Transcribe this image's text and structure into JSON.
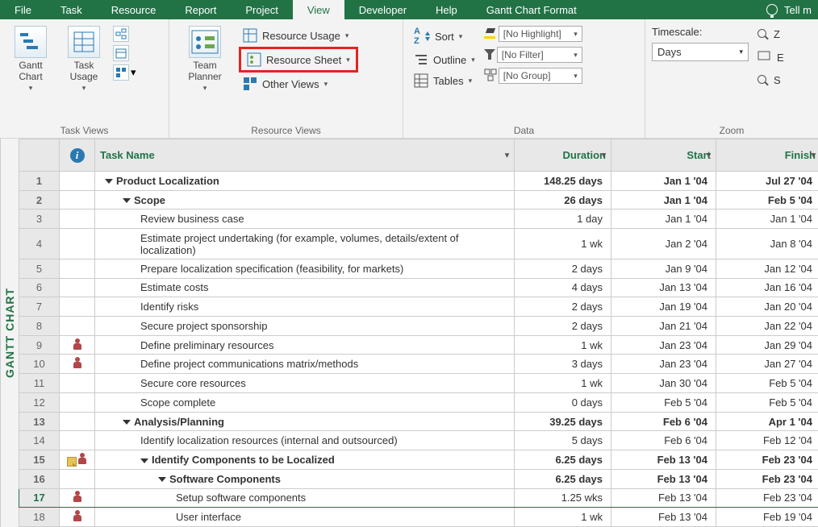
{
  "tabs": [
    "File",
    "Task",
    "Resource",
    "Report",
    "Project",
    "View",
    "Developer",
    "Help",
    "Gantt Chart Format"
  ],
  "active_tab": "View",
  "tellme": "Tell m",
  "ribbon": {
    "gantt_btn": "Gantt\nChart",
    "task_usage_btn": "Task\nUsage",
    "team_planner_btn": "Team\nPlanner",
    "resource_usage": "Resource Usage",
    "resource_sheet": "Resource Sheet",
    "other_views": "Other Views",
    "sort": "Sort",
    "outline": "Outline",
    "tables": "Tables",
    "no_highlight": "[No Highlight]",
    "no_filter": "[No Filter]",
    "no_group": "[No Group]",
    "timescale_label": "Timescale:",
    "timescale_value": "Days",
    "zoom_z": "Z",
    "zoom_e": "E",
    "zoom_s": "S",
    "group_task_views": "Task Views",
    "group_resource_views": "Resource Views",
    "group_data": "Data",
    "group_zoom": "Zoom"
  },
  "rot": "GANTT CHART",
  "columns": {
    "task_name": "Task Name",
    "duration": "Duration",
    "start": "Start",
    "finish": "Finish"
  },
  "rows": [
    {
      "n": 1,
      "ind": "",
      "lvl": 0,
      "sum": true,
      "name": "Product Localization",
      "dur": "148.25 days",
      "start": "Jan 1 '04",
      "fin": "Jul 27 '04"
    },
    {
      "n": 2,
      "ind": "",
      "lvl": 1,
      "sum": true,
      "name": "Scope",
      "dur": "26 days",
      "start": "Jan 1 '04",
      "fin": "Feb 5 '04"
    },
    {
      "n": 3,
      "ind": "",
      "lvl": 2,
      "sum": false,
      "name": "Review business case",
      "dur": "1 day",
      "start": "Jan 1 '04",
      "fin": "Jan 1 '04"
    },
    {
      "n": 4,
      "ind": "",
      "lvl": 2,
      "sum": false,
      "name": "Estimate project undertaking (for example, volumes, details/extent of localization)",
      "dur": "1 wk",
      "start": "Jan 2 '04",
      "fin": "Jan 8 '04"
    },
    {
      "n": 5,
      "ind": "",
      "lvl": 2,
      "sum": false,
      "name": "Prepare localization specification (feasibility, for markets)",
      "dur": "2 days",
      "start": "Jan 9 '04",
      "fin": "Jan 12 '04"
    },
    {
      "n": 6,
      "ind": "",
      "lvl": 2,
      "sum": false,
      "name": "Estimate costs",
      "dur": "4 days",
      "start": "Jan 13 '04",
      "fin": "Jan 16 '04"
    },
    {
      "n": 7,
      "ind": "",
      "lvl": 2,
      "sum": false,
      "name": "Identify risks",
      "dur": "2 days",
      "start": "Jan 19 '04",
      "fin": "Jan 20 '04"
    },
    {
      "n": 8,
      "ind": "",
      "lvl": 2,
      "sum": false,
      "name": "Secure project sponsorship",
      "dur": "2 days",
      "start": "Jan 21 '04",
      "fin": "Jan 22 '04"
    },
    {
      "n": 9,
      "ind": "person",
      "lvl": 2,
      "sum": false,
      "name": "Define preliminary resources",
      "dur": "1 wk",
      "start": "Jan 23 '04",
      "fin": "Jan 29 '04"
    },
    {
      "n": 10,
      "ind": "person",
      "lvl": 2,
      "sum": false,
      "name": "Define project communications matrix/methods",
      "dur": "3 days",
      "start": "Jan 23 '04",
      "fin": "Jan 27 '04"
    },
    {
      "n": 11,
      "ind": "",
      "lvl": 2,
      "sum": false,
      "name": "Secure core resources",
      "dur": "1 wk",
      "start": "Jan 30 '04",
      "fin": "Feb 5 '04"
    },
    {
      "n": 12,
      "ind": "",
      "lvl": 2,
      "sum": false,
      "name": "Scope complete",
      "dur": "0 days",
      "start": "Feb 5 '04",
      "fin": "Feb 5 '04"
    },
    {
      "n": 13,
      "ind": "",
      "lvl": 1,
      "sum": true,
      "name": "Analysis/Planning",
      "dur": "39.25 days",
      "start": "Feb 6 '04",
      "fin": "Apr 1 '04"
    },
    {
      "n": 14,
      "ind": "",
      "lvl": 2,
      "sum": false,
      "name": "Identify localization resources (internal and outsourced)",
      "dur": "5 days",
      "start": "Feb 6 '04",
      "fin": "Feb 12 '04"
    },
    {
      "n": 15,
      "ind": "note-person",
      "lvl": 2,
      "sum": true,
      "name": "Identify Components to be Localized",
      "dur": "6.25 days",
      "start": "Feb 13 '04",
      "fin": "Feb 23 '04"
    },
    {
      "n": 16,
      "ind": "",
      "lvl": 3,
      "sum": true,
      "name": "Software Components",
      "dur": "6.25 days",
      "start": "Feb 13 '04",
      "fin": "Feb 23 '04"
    },
    {
      "n": 17,
      "ind": "person",
      "lvl": 4,
      "sum": false,
      "sel": true,
      "name": "Setup software components",
      "dur": "1.25 wks",
      "start": "Feb 13 '04",
      "fin": "Feb 23 '04"
    },
    {
      "n": 18,
      "ind": "person",
      "lvl": 4,
      "sum": false,
      "name": "User interface",
      "dur": "1 wk",
      "start": "Feb 13 '04",
      "fin": "Feb 19 '04"
    }
  ]
}
